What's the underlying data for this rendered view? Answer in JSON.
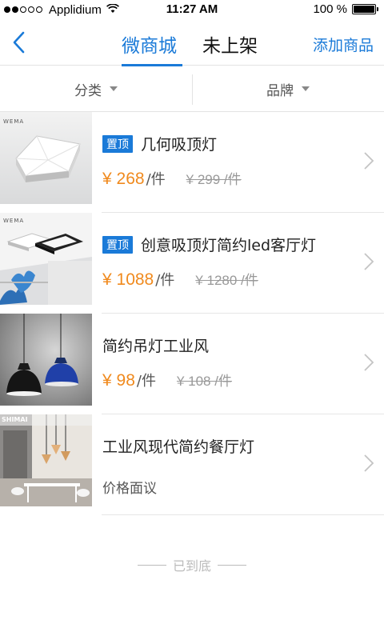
{
  "status_bar": {
    "carrier": "Applidium",
    "time": "11:27 AM",
    "battery": "100 %",
    "signal_bars_full": 2,
    "signal_bars_total": 5
  },
  "nav": {
    "back_icon": "chevron-left-icon",
    "tabs": [
      {
        "label": "微商城",
        "active": true
      },
      {
        "label": "未上架",
        "active": false
      }
    ],
    "action_label": "添加商品",
    "accent_color": "#1a7ad8"
  },
  "filters": [
    {
      "label": "分类"
    },
    {
      "label": "品牌"
    }
  ],
  "products": [
    {
      "pinned": true,
      "pin_label": "置顶",
      "title": "几何吸顶灯",
      "price": "¥ 268",
      "unit": "/件",
      "old_price": "¥ 299 /件"
    },
    {
      "pinned": true,
      "pin_label": "置顶",
      "title": "创意吸顶灯简约led客厅灯",
      "price": "¥ 1088",
      "unit": "/件",
      "old_price": "¥ 1280 /件"
    },
    {
      "pinned": false,
      "title": "简约吊灯工业风",
      "price": "¥ 98",
      "unit": "/件",
      "old_price": "¥ 108 /件"
    },
    {
      "pinned": false,
      "title": "工业风现代简约餐厅灯",
      "price_text": "价格面议"
    }
  ],
  "thumb_brand_marks": [
    "WEMA",
    "WEMA",
    "SHIMAI"
  ],
  "footer": {
    "end_text": "已到底"
  },
  "colors": {
    "accent": "#1a7ad8",
    "price": "#f08a1e"
  }
}
